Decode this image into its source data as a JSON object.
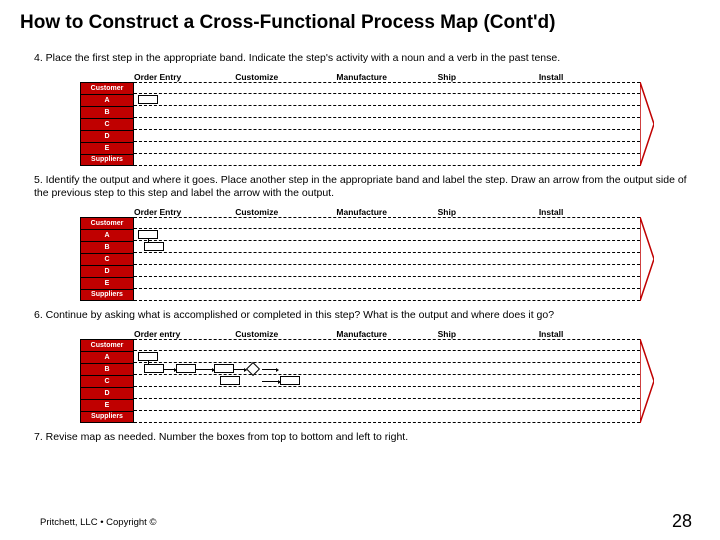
{
  "title": "How to Construct a Cross-Functional Process Map (Cont'd)",
  "steps": {
    "s4": "4. Place the first step in the appropriate band. Indicate the step's activity with a noun and a verb in the past tense.",
    "s5": "5. Identify the output and where it goes. Place another step in the appropriate band and label the step. Draw an arrow from the output side of the previous step to this step and label the arrow with the output.",
    "s6": "6. Continue by asking what is accomplished or completed in this step? What is the output and where does it go?",
    "s7": "7. Revise map as needed. Number the boxes from top to bottom and left to right."
  },
  "phases_a": [
    "Order Entry",
    "Customize",
    "Manufacture",
    "Ship",
    "Install"
  ],
  "phases_b": [
    "Order entry",
    "Customize",
    "Manufacture",
    "Ship",
    "Install"
  ],
  "lanes": [
    "Customer",
    "A",
    "B",
    "C",
    "D",
    "E",
    "Suppliers"
  ],
  "footer": "Pritchett, LLC • Copyright ©",
  "pagenum": "28"
}
